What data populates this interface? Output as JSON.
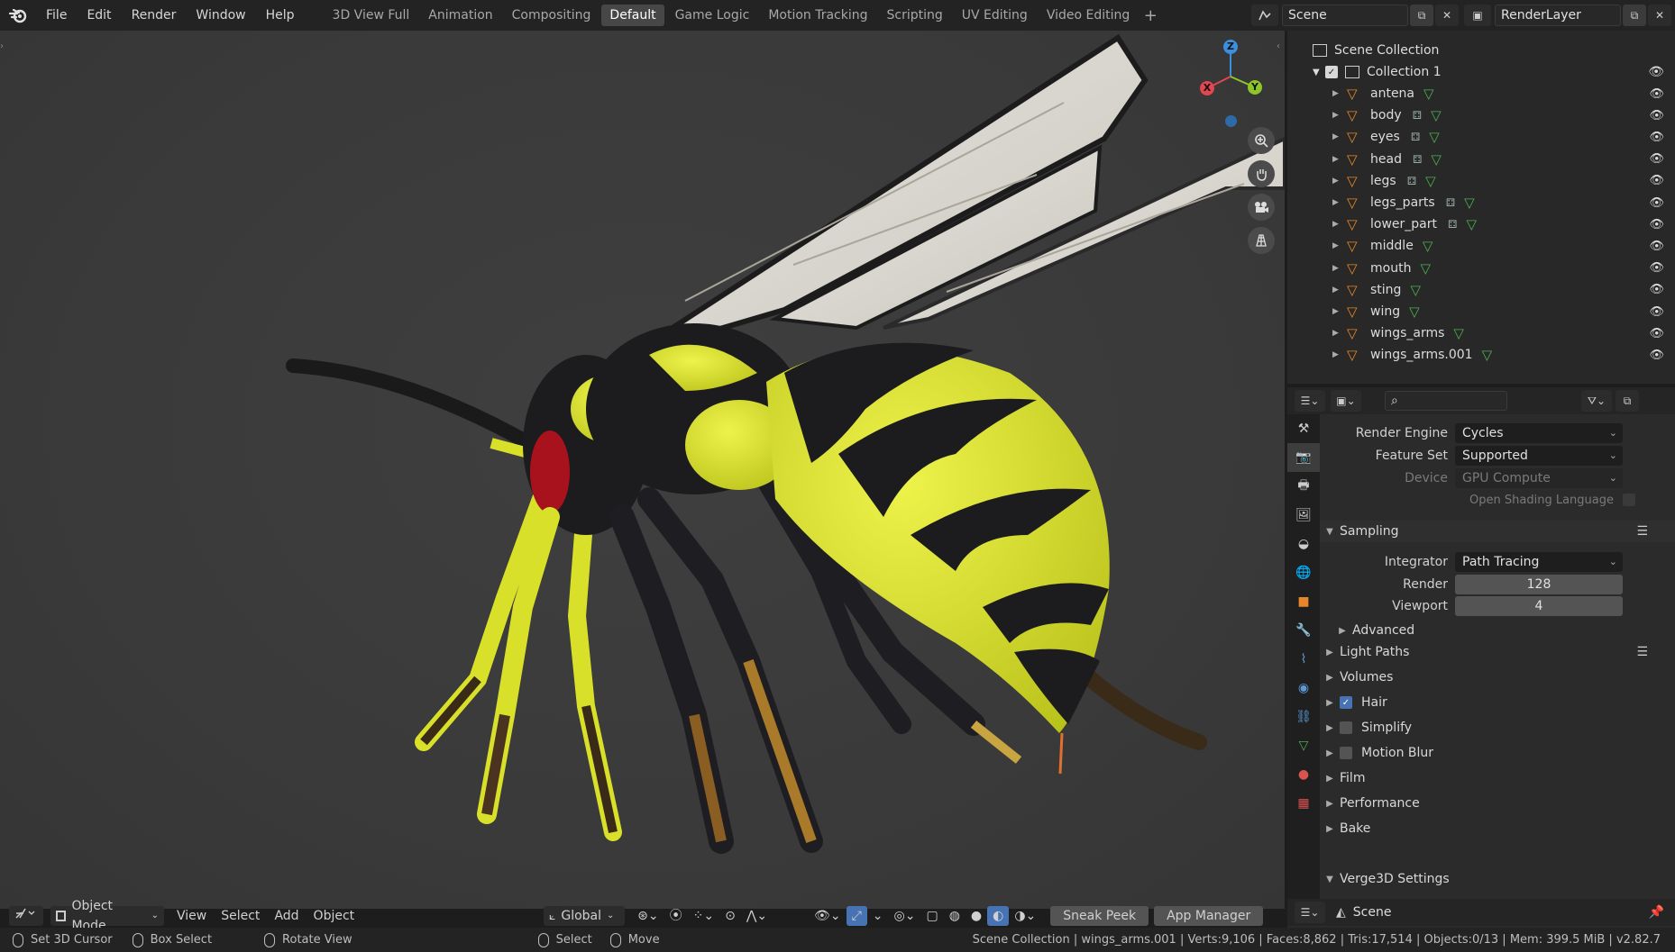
{
  "menu": [
    "File",
    "Edit",
    "Render",
    "Window",
    "Help"
  ],
  "workspaces": [
    {
      "label": "3D View Full",
      "active": false
    },
    {
      "label": "Animation",
      "active": false
    },
    {
      "label": "Compositing",
      "active": false
    },
    {
      "label": "Default",
      "active": true
    },
    {
      "label": "Game Logic",
      "active": false
    },
    {
      "label": "Motion Tracking",
      "active": false
    },
    {
      "label": "Scripting",
      "active": false
    },
    {
      "label": "UV Editing",
      "active": false
    },
    {
      "label": "Video Editing",
      "active": false
    }
  ],
  "header": {
    "scene_name": "Scene",
    "view_layer": "RenderLayer",
    "add_tab": "+"
  },
  "gizmo": {
    "z": "Z",
    "x": "X",
    "y": "Y"
  },
  "viewport_header": {
    "mode": "Object Mode",
    "menus": [
      "View",
      "Select",
      "Add",
      "Object"
    ],
    "orientation": "Global",
    "sneak_peek": "Sneak Peek",
    "app_manager": "App Manager"
  },
  "outliner": {
    "root": "Scene Collection",
    "collection": "Collection 1",
    "objects": [
      {
        "name": "antena",
        "modifier": false
      },
      {
        "name": "body",
        "modifier": true
      },
      {
        "name": "eyes",
        "modifier": true
      },
      {
        "name": "head",
        "modifier": true
      },
      {
        "name": "legs",
        "modifier": true
      },
      {
        "name": "legs_parts",
        "modifier": true
      },
      {
        "name": "lower_part",
        "modifier": true
      },
      {
        "name": "middle",
        "modifier": false
      },
      {
        "name": "mouth",
        "modifier": false
      },
      {
        "name": "sting",
        "modifier": false
      },
      {
        "name": "wing",
        "modifier": false
      },
      {
        "name": "wings_arms",
        "modifier": false
      },
      {
        "name": "wings_arms.001",
        "modifier": false
      }
    ]
  },
  "properties": {
    "render_engine_label": "Render Engine",
    "render_engine": "Cycles",
    "feature_set_label": "Feature Set",
    "feature_set": "Supported",
    "device_label": "Device",
    "device": "GPU Compute",
    "osl_label": "Open Shading Language",
    "sampling": "Sampling",
    "integrator_label": "Integrator",
    "integrator": "Path Tracing",
    "render_label": "Render",
    "render_samples": "128",
    "viewport_label": "Viewport",
    "viewport_samples": "4",
    "advanced": "Advanced",
    "panels": [
      {
        "label": "Light Paths",
        "checkbox": null
      },
      {
        "label": "Volumes",
        "checkbox": null
      },
      {
        "label": "Hair",
        "checkbox": true
      },
      {
        "label": "Simplify",
        "checkbox": false
      },
      {
        "label": "Motion Blur",
        "checkbox": false
      },
      {
        "label": "Film",
        "checkbox": null
      },
      {
        "label": "Performance",
        "checkbox": null
      },
      {
        "label": "Bake",
        "checkbox": null
      }
    ],
    "verge": "Verge3D Settings",
    "footer_scene": "Scene"
  },
  "status": {
    "set_cursor": "Set 3D Cursor",
    "box_select": "Box Select",
    "rotate_view": "Rotate View",
    "select": "Select",
    "move": "Move",
    "stats": "Scene Collection | wings_arms.001 | Verts:9,106 | Faces:8,862 | Tris:17,514 | Objects:0/13 | Mem: 399.5 MiB | v2.82.7"
  },
  "colors": {
    "accent": "#4772b3",
    "mesh_orange": "#e8862a",
    "data_green": "#4caf50",
    "axis_x": "#e0474f",
    "axis_y": "#8ec627",
    "axis_z": "#3a8fde"
  }
}
